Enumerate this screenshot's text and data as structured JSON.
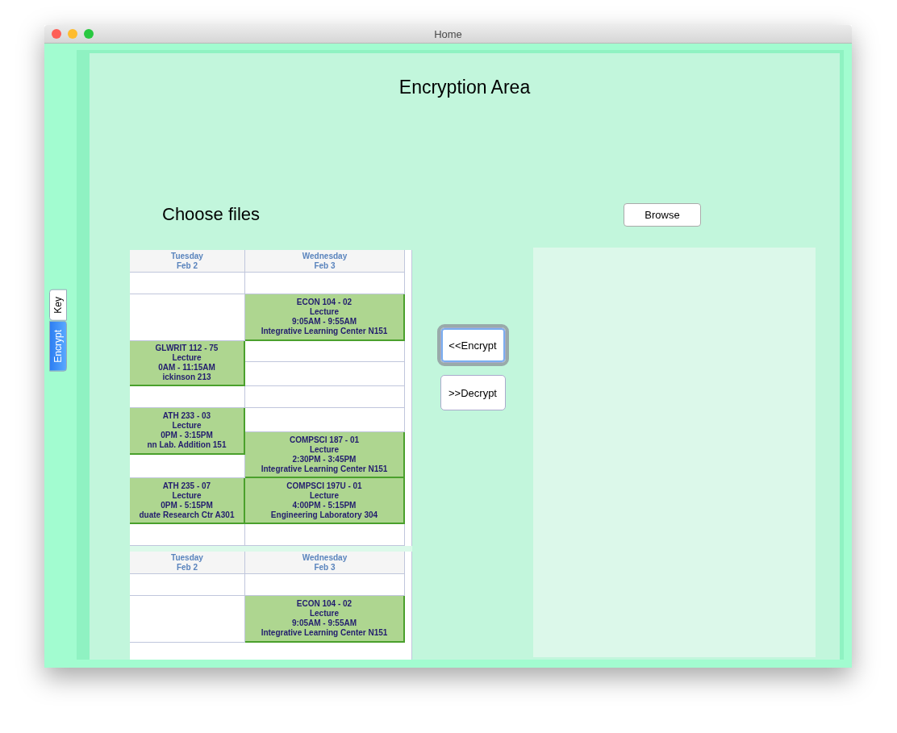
{
  "window": {
    "title": "Home"
  },
  "side_tabs": [
    {
      "label": "Key",
      "selected": false
    },
    {
      "label": "Encrypt",
      "selected": true
    }
  ],
  "heading": "Encryption Area",
  "choose_label": "Choose files",
  "browse_button": "Browse",
  "actions": [
    {
      "label": "<<Encrypt",
      "focused": true
    },
    {
      "label": ">>Decrypt",
      "focused": false
    }
  ],
  "file_preview": {
    "copies": [
      {
        "columns": [
          {
            "day": "Tuesday",
            "date": "Feb 2",
            "slots": [
              {
                "kind": "empty"
              },
              {
                "kind": "empty"
              },
              {
                "kind": "event",
                "lines": [
                  "GLWRIT 112 - 75",
                  "Lecture",
                  "0AM - 11:15AM",
                  "ickinson 213"
                ]
              },
              {
                "kind": "empty"
              },
              {
                "kind": "event",
                "lines": [
                  "ATH 233 - 03",
                  "Lecture",
                  "0PM - 3:15PM",
                  "nn Lab. Addition 151"
                ]
              },
              {
                "kind": "empty"
              },
              {
                "kind": "event",
                "lines": [
                  "ATH 235 - 07",
                  "Lecture",
                  "0PM - 5:15PM",
                  "duate Research Ctr A301"
                ]
              },
              {
                "kind": "empty"
              }
            ]
          },
          {
            "day": "Wednesday",
            "date": "Feb 3",
            "slots": [
              {
                "kind": "empty"
              },
              {
                "kind": "event",
                "lines": [
                  "ECON 104 - 02",
                  "Lecture",
                  "9:05AM - 9:55AM",
                  "Integrative Learning Center N151"
                ]
              },
              {
                "kind": "empty"
              },
              {
                "kind": "empty"
              },
              {
                "kind": "empty"
              },
              {
                "kind": "empty"
              },
              {
                "kind": "event",
                "lines": [
                  "COMPSCI 187 - 01",
                  "Lecture",
                  "2:30PM - 3:45PM",
                  "Integrative Learning Center N151"
                ]
              },
              {
                "kind": "event",
                "lines": [
                  "COMPSCI 197U - 01",
                  "Lecture",
                  "4:00PM - 5:15PM",
                  "Engineering Laboratory 304"
                ]
              },
              {
                "kind": "empty"
              }
            ]
          }
        ]
      },
      {
        "columns": [
          {
            "day": "Tuesday",
            "date": "Feb 2",
            "slots": [
              {
                "kind": "empty"
              },
              {
                "kind": "empty"
              }
            ]
          },
          {
            "day": "Wednesday",
            "date": "Feb 3",
            "slots": [
              {
                "kind": "empty"
              },
              {
                "kind": "event",
                "lines": [
                  "ECON 104 - 02",
                  "Lecture",
                  "9:05AM - 9:55AM",
                  "Integrative Learning Center N151"
                ]
              }
            ]
          }
        ]
      }
    ]
  }
}
